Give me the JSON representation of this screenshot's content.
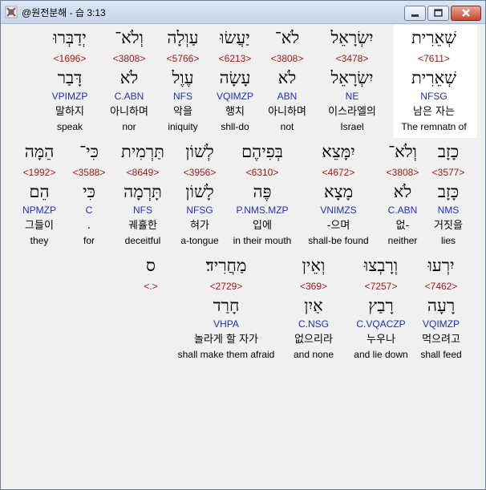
{
  "window": {
    "title": "@원전분해 - 습 3:13",
    "accent": "#c6d5ea"
  },
  "verse": {
    "lines": [
      {
        "words": [
          {
            "heb": "שְׁאֵרִית",
            "num": "<7611>",
            "root": "שְׁאֵרִית",
            "parse": "NFSG",
            "kor": "남은 자는",
            "eng": "The remnatn of",
            "highlight": true
          },
          {
            "heb": "יִשְׂרָאֵל",
            "num": "<3478>",
            "root": "יִשְׂרָאֵל",
            "parse": "NE",
            "kor": "이스라엘의",
            "eng": "Israel"
          },
          {
            "heb": "לֹא־",
            "num": "<3808>",
            "root": "לֹא",
            "parse": "ABN",
            "kor": "아니하며",
            "eng": "not"
          },
          {
            "heb": "יַעֲשׂוּ",
            "num": "<6213>",
            "root": "עָשָׂה",
            "parse": "VQIMZP",
            "kor": "행치",
            "eng": "shll-do"
          },
          {
            "heb": "עַוְלָה",
            "num": "<5766>",
            "root": "עֶוֶל",
            "parse": "NFS",
            "kor": "악을",
            "eng": "iniquity"
          },
          {
            "heb": "וְלֹא־",
            "num": "<3808>",
            "root": "לֹא",
            "parse": "C.ABN",
            "kor": "아니하며",
            "eng": "nor"
          },
          {
            "heb": "יְדַבְּרוּ",
            "num": "<1696>",
            "root": "דָּבַר",
            "parse": "VPIMZP",
            "kor": "말하지",
            "eng": "speak"
          }
        ]
      },
      {
        "words": [
          {
            "heb": "כָזָב",
            "num": "<3577>",
            "root": "כָּזָב",
            "parse": "NMS",
            "kor": "거짓을",
            "eng": "lies"
          },
          {
            "heb": "וְלֹא־",
            "num": "<3808>",
            "root": "לֹא",
            "parse": "C.ABN",
            "kor": "없-",
            "eng": "neither"
          },
          {
            "heb": "יִמָּצֵא",
            "num": "<4672>",
            "root": "מָצָא",
            "parse": "VNIMZS",
            "kor": "-으며",
            "eng": "shall-be found"
          },
          {
            "heb": "בְּפִיהֶם",
            "num": "<6310>",
            "root": "פֶּה",
            "parse": "P.NMS.MZP",
            "kor": "입에",
            "eng": "in their mouth"
          },
          {
            "heb": "לְשׁוֹן",
            "num": "<3956>",
            "root": "לָשׁוֹן",
            "parse": "NFSG",
            "kor": "혀가",
            "eng": "a-tongue"
          },
          {
            "heb": "תַּרְמִית",
            "num": "<8649>",
            "root": "תָּרְמָה",
            "parse": "NFS",
            "kor": "궤휼한",
            "eng": "deceitful"
          },
          {
            "heb": "כִּי־",
            "num": "<3588>",
            "root": "כִּי",
            "parse": "C",
            "kor": ".",
            "eng": "for"
          },
          {
            "heb": "הֵמָּה",
            "num": "<1992>",
            "root": "הֵם",
            "parse": "NPMZP",
            "kor": "그들이",
            "eng": "they"
          }
        ]
      },
      {
        "words": [
          {
            "heb": "יִרְעוּ",
            "num": "<7462>",
            "root": "רָעָה",
            "parse": "VQIMZP",
            "kor": "먹으려고",
            "eng": "shall feed"
          },
          {
            "heb": "וְרָבְצוּ",
            "num": "<7257>",
            "root": "רָבַץ",
            "parse": "C.VQACZP",
            "kor": "누우나",
            "eng": "and lie down"
          },
          {
            "heb": "וְאֵין",
            "num": "<369>",
            "root": "אַיִן",
            "parse": "C.NSG",
            "kor": "없으리라",
            "eng": "and none"
          },
          {
            "heb": "מַחֲרִיד׃",
            "num": "<2729>",
            "root": "חָרַד",
            "parse": "VHPA",
            "kor": "놀라게 할 자가",
            "eng": "shall make them afraid"
          },
          {
            "heb": "ס",
            "num": "<.>",
            "root": "",
            "parse": "",
            "kor": "",
            "eng": ""
          }
        ]
      }
    ]
  }
}
